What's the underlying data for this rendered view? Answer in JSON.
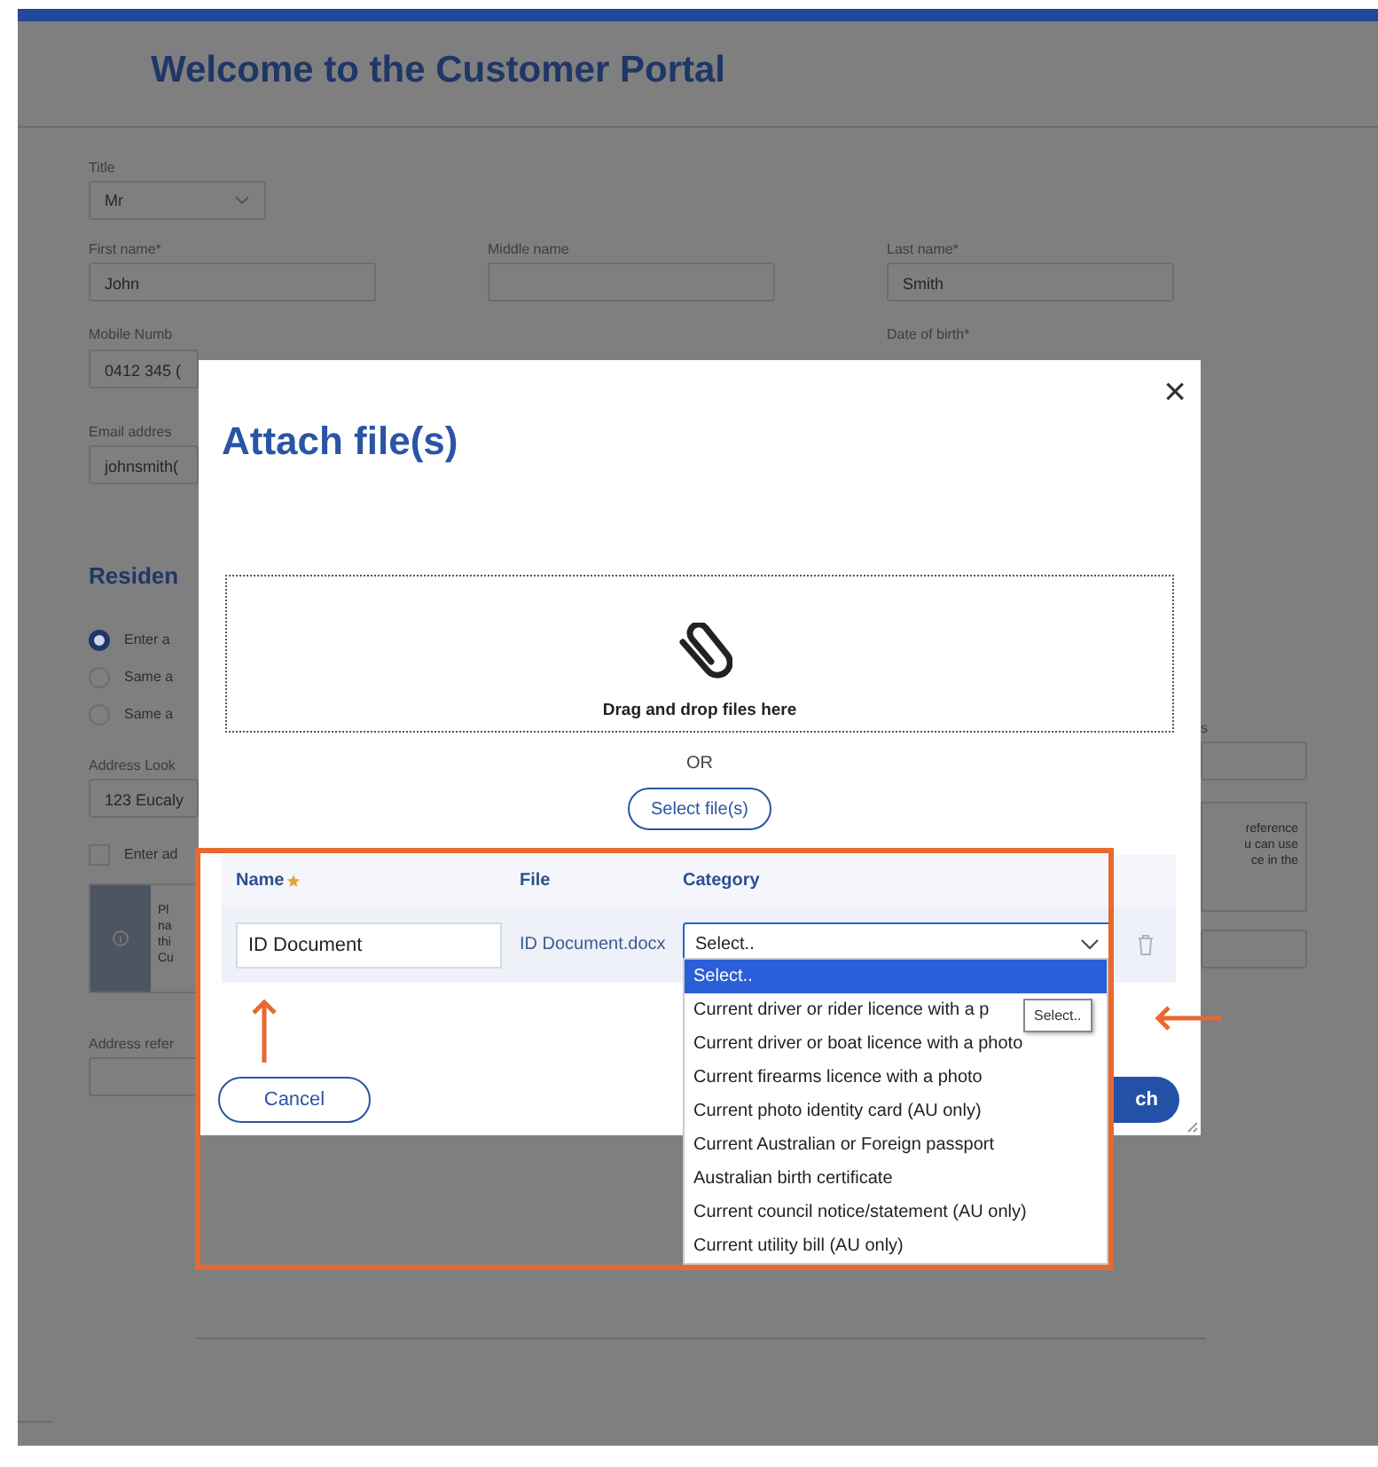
{
  "header": {
    "title": "Welcome to the Customer Portal"
  },
  "form": {
    "title_field": {
      "label": "Title",
      "value": "Mr"
    },
    "name_fields": [
      {
        "label": "First name*",
        "value": "John"
      },
      {
        "label": "Middle name"
      },
      {
        "label": "Last name*",
        "value": "Smith"
      }
    ],
    "row_labels": [
      "Mobile Numb",
      "Date of birth*"
    ],
    "left_strip": [
      {
        "kind": "input",
        "value": "0412 345 ("
      },
      {
        "kind": "label",
        "text": "Email addres"
      },
      {
        "kind": "input",
        "value": "johnsmith("
      },
      {
        "kind": "heading",
        "text": "Residen"
      },
      {
        "kind": "radio",
        "text": "Enter a",
        "selected": true
      },
      {
        "kind": "radio",
        "text": "Same a",
        "selected": false
      },
      {
        "kind": "radio",
        "text": "Same a",
        "selected": false
      },
      {
        "kind": "label",
        "text": "Address Look"
      },
      {
        "kind": "input",
        "value": "123 Eucaly"
      },
      {
        "kind": "checkbox",
        "text": "Enter ad",
        "checked": false
      },
      {
        "kind": "info",
        "lines": [
          "Pl",
          "na",
          "thi",
          "Cu"
        ]
      },
      {
        "kind": "label",
        "text": "Address refer"
      },
      {
        "kind": "input"
      }
    ],
    "right_strip": [
      {
        "kind": "label",
        "text": "s"
      },
      {
        "kind": "input"
      },
      {
        "kind": "info",
        "lines": [
          "reference",
          "u can use",
          "ce in the"
        ]
      },
      {
        "kind": "input"
      }
    ]
  },
  "modal": {
    "title": "Attach file(s)",
    "close": "×",
    "dropzone": {
      "text": "Drag and drop files here"
    },
    "or": "OR",
    "select_button": "Select file(s)",
    "table": {
      "columns": [
        {
          "label": "Name",
          "required": true
        },
        {
          "label": "File"
        },
        {
          "label": "Category"
        }
      ],
      "rows": [
        {
          "name": "ID Document",
          "file": "ID Document.docx",
          "category": "Select.."
        }
      ]
    },
    "dropdown": {
      "options": [
        {
          "label": "Select..",
          "selected": true
        },
        {
          "label": "Current driver or rider licence with a p",
          "selected": false
        },
        {
          "label": "Current driver or boat licence with a photo",
          "selected": false
        },
        {
          "label": "Current firearms licence with a photo",
          "selected": false
        },
        {
          "label": "Current photo identity card (AU only)",
          "selected": false
        },
        {
          "label": "Current Australian or Foreign passport",
          "selected": false
        },
        {
          "label": "Australian birth certificate",
          "selected": false
        },
        {
          "label": "Current council notice/statement (AU only)",
          "selected": false
        },
        {
          "label": "Current utility bill (AU only)",
          "selected": false
        }
      ],
      "tooltip": "Select.."
    },
    "buttons": {
      "cancel": "Cancel",
      "attach": "ch"
    }
  }
}
